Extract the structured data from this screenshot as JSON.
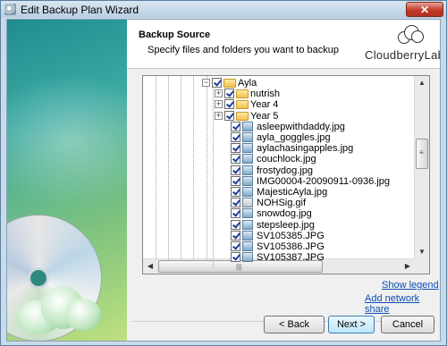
{
  "window": {
    "title": "Edit Backup Plan Wizard",
    "close_glyph": "✕"
  },
  "header": {
    "title": "Backup Source",
    "subtitle": "Specify files and folders you want to backup",
    "brand": "CloudberryLab"
  },
  "tree": {
    "root": "Ayla",
    "folders": [
      "nutrish",
      "Year 4",
      "Year 5"
    ],
    "files": [
      {
        "name": "asleepwithdaddy.jpg",
        "icon": "image-icon"
      },
      {
        "name": "ayla_goggles.jpg",
        "icon": "image-icon"
      },
      {
        "name": "aylachasingapples.jpg",
        "icon": "image-icon"
      },
      {
        "name": "couchlock.jpg",
        "icon": "image-icon"
      },
      {
        "name": "frostydog.jpg",
        "icon": "image-icon"
      },
      {
        "name": "IMG00004-20090911-0936.jpg",
        "icon": "image-icon"
      },
      {
        "name": "MajesticAyla.jpg",
        "icon": "image-icon"
      },
      {
        "name": "NOHSig.gif",
        "icon": "gif-icon"
      },
      {
        "name": "snowdog.jpg",
        "icon": "image-icon"
      },
      {
        "name": "stepsleep.jpg",
        "icon": "image-icon"
      },
      {
        "name": "SV105385.JPG",
        "icon": "image-icon"
      },
      {
        "name": "SV105386.JPG",
        "icon": "image-icon"
      },
      {
        "name": "SV105387.JPG",
        "icon": "image-icon"
      }
    ]
  },
  "links": {
    "show_legend": "Show legend",
    "add_network_share": "Add network share"
  },
  "buttons": {
    "back": "< Back",
    "next": "Next >",
    "cancel": "Cancel"
  }
}
